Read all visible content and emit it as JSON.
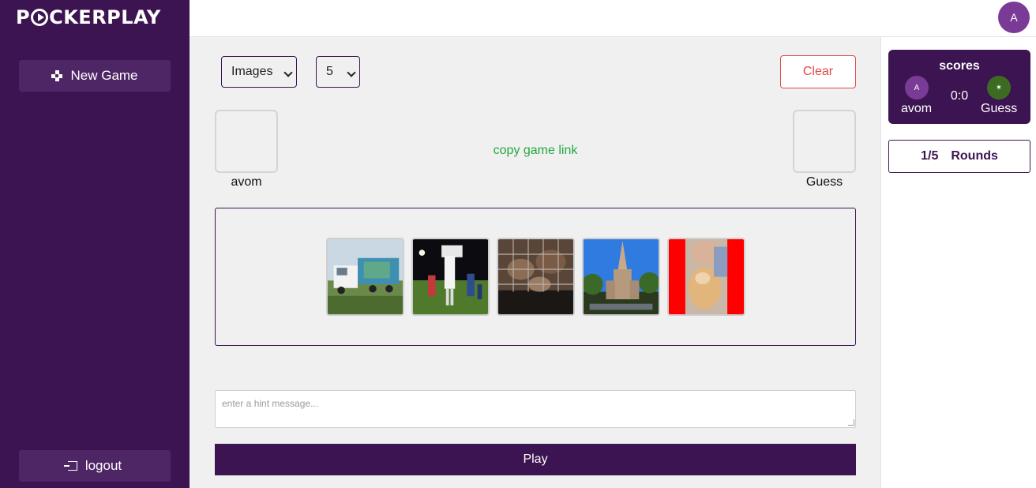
{
  "app": {
    "logo_text": "P●CKERPLAY",
    "logo_before": "P",
    "logo_after": "CKERPLAY"
  },
  "sidebar": {
    "new_game_label": "New Game",
    "logout_label": "logout"
  },
  "header": {
    "user_initial": "A"
  },
  "controls": {
    "mode_select": {
      "value": "Images",
      "options": [
        "Images"
      ]
    },
    "count_select": {
      "value": "5",
      "options": [
        "5"
      ]
    },
    "clear_label": "Clear"
  },
  "players": {
    "left_name": "avom",
    "right_name": "Guess"
  },
  "copy_link_label": "copy game link",
  "images": [
    {
      "name": "truck-image",
      "description_icon": "image-icon"
    },
    {
      "name": "football-field-image",
      "description_icon": "image-icon"
    },
    {
      "name": "cage-image",
      "description_icon": "image-icon"
    },
    {
      "name": "church-image",
      "description_icon": "image-icon"
    },
    {
      "name": "cat-photo-image",
      "description_icon": "image-icon"
    }
  ],
  "hint": {
    "placeholder": "enter a hint message...",
    "value": ""
  },
  "play_label": "Play",
  "scores": {
    "title": "scores",
    "player_a_initial": "A",
    "player_a_name": "avom",
    "player_b_initial": "✶",
    "player_b_name": "Guess",
    "score": "0:0"
  },
  "rounds": {
    "count": "1/5",
    "label": "Rounds"
  },
  "colors": {
    "brand": "#3d1452",
    "accent_green": "#22a93f",
    "danger": "#e04848"
  }
}
